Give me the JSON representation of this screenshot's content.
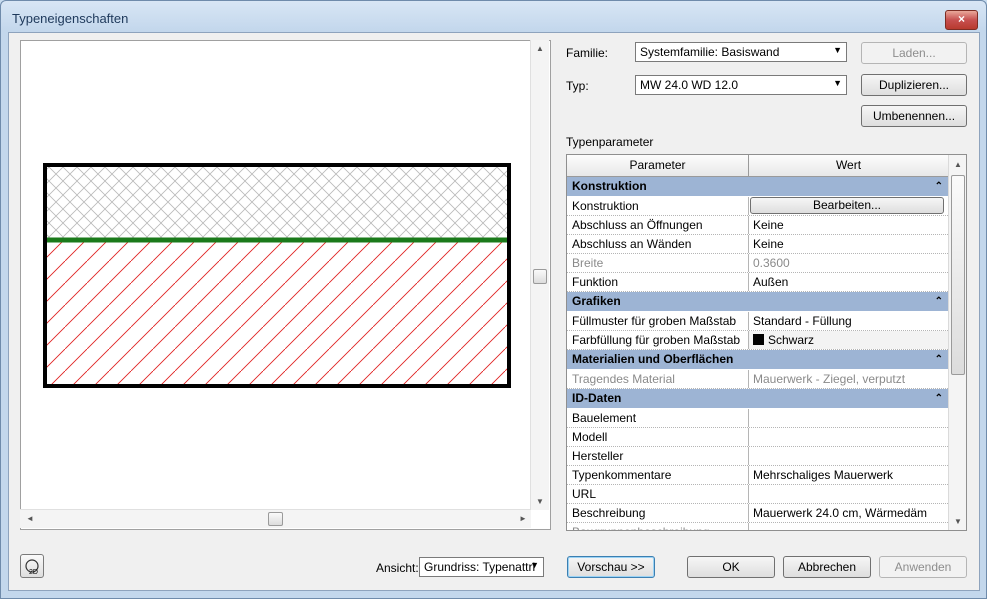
{
  "window": {
    "title": "Typeneigenschaften",
    "close_glyph": "×"
  },
  "familie": {
    "label": "Familie:",
    "value": "Systemfamilie: Basiswand"
  },
  "typ": {
    "label": "Typ:",
    "value": "MW 24.0 WD 12.0"
  },
  "buttons": {
    "laden": "Laden...",
    "duplizieren": "Duplizieren...",
    "umbenennen": "Umbenennen...",
    "vorschau": "Vorschau >>",
    "ok": "OK",
    "abbrechen": "Abbrechen",
    "anwenden": "Anwenden"
  },
  "typenparameter_label": "Typenparameter",
  "grid": {
    "col_parameter": "Parameter",
    "col_wert": "Wert",
    "bearbeiten": "Bearbeiten...",
    "sections": [
      {
        "title": "Konstruktion",
        "rows": [
          {
            "param": "Konstruktion",
            "value": ""
          },
          {
            "param": "Abschluss an Öffnungen",
            "value": "Keine"
          },
          {
            "param": "Abschluss an Wänden",
            "value": "Keine"
          },
          {
            "param": "Breite",
            "value": "0.3600"
          },
          {
            "param": "Funktion",
            "value": "Außen"
          }
        ]
      },
      {
        "title": "Grafiken",
        "rows": [
          {
            "param": "Füllmuster für groben Maßstab",
            "value": "Standard - Füllung"
          },
          {
            "param": "Farbfüllung für groben Maßstab",
            "value": "Schwarz"
          }
        ]
      },
      {
        "title": "Materialien und Oberflächen",
        "rows": [
          {
            "param": "Tragendes Material",
            "value": "Mauerwerk - Ziegel, verputzt"
          }
        ]
      },
      {
        "title": "ID-Daten",
        "rows": [
          {
            "param": "Bauelement",
            "value": ""
          },
          {
            "param": "Modell",
            "value": ""
          },
          {
            "param": "Hersteller",
            "value": ""
          },
          {
            "param": "Typenkommentare",
            "value": "Mehrschaliges Mauerwerk"
          },
          {
            "param": "URL",
            "value": ""
          },
          {
            "param": "Beschreibung",
            "value": "Mauerwerk 24.0 cm, Wärmedäm"
          },
          {
            "param": "Baugruppenbeschreibung",
            "value": ""
          }
        ]
      }
    ]
  },
  "ansicht": {
    "label": "Ansicht:",
    "value": "Grundriss: Typenattri"
  },
  "icons": {
    "collapse": "chevron-up-icon",
    "preview2d": "2d-view-icon"
  },
  "colors": {
    "category_bg": "#9db4d4",
    "hatch_red": "#e02020",
    "layer_green": "#1a7a1a"
  }
}
